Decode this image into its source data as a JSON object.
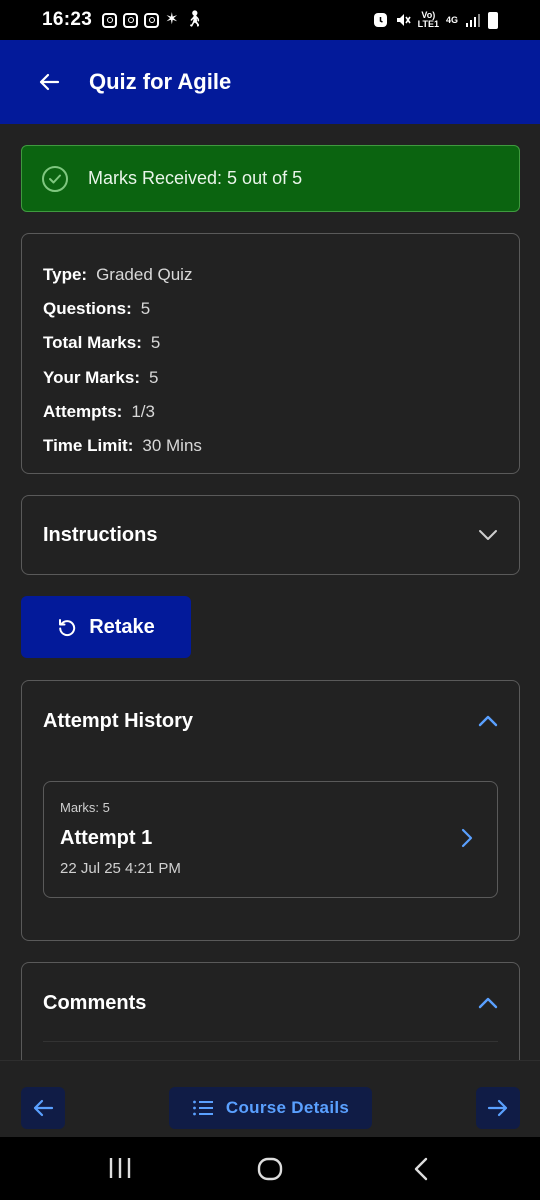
{
  "status_bar": {
    "time": "16:23",
    "network_top": "Vo)",
    "network_bottom": "LTE1",
    "network_type": "4G",
    "icons": [
      "instagram-icon",
      "instagram-icon",
      "instagram-icon",
      "asterisk-icon",
      "walking-icon",
      "alarm-icon",
      "mute-icon",
      "signal-icon",
      "battery-icon"
    ]
  },
  "app_bar": {
    "title": "Quiz for Agile"
  },
  "result": {
    "message": "Marks Received: 5 out of 5"
  },
  "info": {
    "rows": [
      {
        "label": "Type:",
        "value": "Graded Quiz"
      },
      {
        "label": "Questions:",
        "value": "5"
      },
      {
        "label": "Total Marks:",
        "value": "5"
      },
      {
        "label": "Your Marks:",
        "value": "5"
      },
      {
        "label": "Attempts:",
        "value": "1/3"
      },
      {
        "label": "Time Limit:",
        "value": "30 Mins"
      }
    ]
  },
  "instructions": {
    "title": "Instructions"
  },
  "retake": {
    "label": "Retake"
  },
  "attempt_history": {
    "title": "Attempt History",
    "attempts": [
      {
        "marks": "Marks: 5",
        "name": "Attempt 1",
        "date": "22 Jul 25 4:21 PM"
      }
    ]
  },
  "comments": {
    "title": "Comments"
  },
  "bottom_nav": {
    "course_details_label": "Course Details"
  },
  "colors": {
    "app_bar": "#031a9a",
    "success_bg": "#0b6410",
    "accent_blue": "#5aa0ff",
    "background": "#222222"
  }
}
